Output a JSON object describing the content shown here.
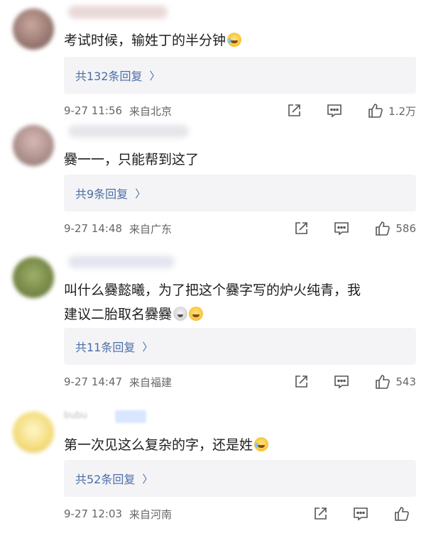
{
  "comments": [
    {
      "text": "考试时候，输姓丁的半分钟",
      "emoji": "laugh-tear-emoji",
      "replies": "共132条回复",
      "time": "9-27 11:56",
      "location": "来自北京",
      "likes": "1.2万"
    },
    {
      "text": "爨一一，只能帮到这了",
      "emoji": "",
      "replies": "共9条回复",
      "time": "9-27 14:48",
      "location": "来自广东",
      "likes": "586"
    },
    {
      "text_line1": "叫什么爨懿曦，为了把这个爨字写的炉火纯青，我",
      "text_line2": "建议二胎取名爨爨",
      "emoji": "dizzy-emoji, grin-emoji",
      "replies": "共11条回复",
      "time": "9-27 14:47",
      "location": "来自福建",
      "likes": "543"
    },
    {
      "username": "bubu",
      "text": "第一次见这么复杂的字，还是姓",
      "emoji": "laugh-tear-emoji",
      "replies": "共52条回复",
      "time": "9-27 12:03",
      "location": "来自河南",
      "likes": ""
    }
  ],
  "icons": {
    "share": "share-icon",
    "comment": "comment-icon",
    "like": "thumbs-up-icon",
    "chevron": "chevron-right-icon"
  },
  "colors": {
    "reply_link": "#4a6ea8",
    "reply_bg": "#f4f4f6",
    "meta_text": "#666666"
  }
}
